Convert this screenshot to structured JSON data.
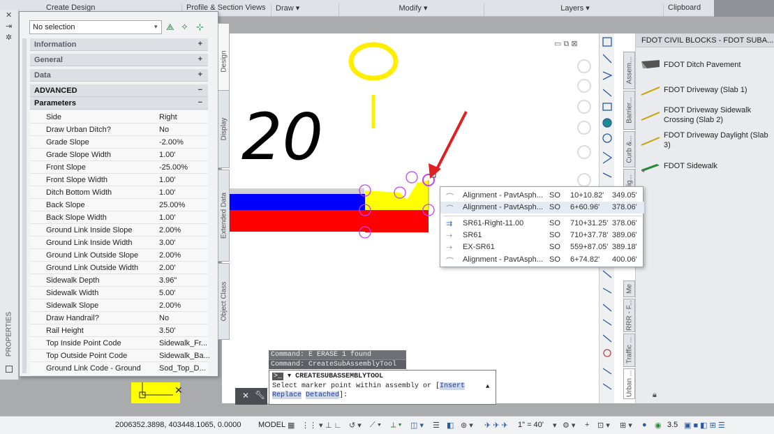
{
  "ribbon": {
    "panels": [
      "Create Design",
      "Profile & Section Views",
      "Draw ▾",
      "Modify ▾",
      "Layers ▾",
      "Clipboard"
    ]
  },
  "properties": {
    "selection": "No selection",
    "sidebar_label": "PROPERTIES",
    "sections": [
      {
        "label": "Information",
        "toggle": "+"
      },
      {
        "label": "General",
        "toggle": "+"
      },
      {
        "label": "Data",
        "toggle": "+"
      },
      {
        "label": "ADVANCED",
        "toggle": "−"
      },
      {
        "label": "Parameters",
        "toggle": "−"
      }
    ],
    "parameters": [
      {
        "label": "Side",
        "value": "Right"
      },
      {
        "label": "Draw Urban Ditch?",
        "value": "No"
      },
      {
        "label": "Grade Slope",
        "value": "-2.00%"
      },
      {
        "label": "Grade Slope Width",
        "value": "1.00'"
      },
      {
        "label": "Front Slope",
        "value": "-25.00%"
      },
      {
        "label": "Front Slope Width",
        "value": "1.00'"
      },
      {
        "label": "Ditch Bottom Width",
        "value": "1.00'"
      },
      {
        "label": "Back Slope",
        "value": "25.00%"
      },
      {
        "label": "Back Slope Width",
        "value": "1.00'"
      },
      {
        "label": "Ground Link Inside Slope",
        "value": "2.00%"
      },
      {
        "label": "Ground Link Inside Width",
        "value": "3.00'"
      },
      {
        "label": "Ground Link Outside Slope",
        "value": "2.00%"
      },
      {
        "label": "Ground Link Outside Width",
        "value": "2.00'"
      },
      {
        "label": "Sidewalk Depth",
        "value": "3.96\""
      },
      {
        "label": "Sidewalk Width",
        "value": "5.00'"
      },
      {
        "label": "Sidewalk Slope",
        "value": "2.00%"
      },
      {
        "label": "Draw Handrail?",
        "value": "No"
      },
      {
        "label": "Rail Height",
        "value": "3.50'"
      },
      {
        "label": "Top Inside Point Code",
        "value": "Sidewalk_Fr..."
      },
      {
        "label": "Top Outside Point Code",
        "value": "Sidewalk_Ba..."
      },
      {
        "label": "Ground Link Code - Ground",
        "value": "Sod_Top_D..."
      }
    ],
    "tabs": [
      "Design",
      "Display",
      "Extended Data",
      "Object Class"
    ]
  },
  "viewport": {
    "sketch_text": "20"
  },
  "popup": {
    "rows": [
      {
        "name": "Alignment - PavtAsph...",
        "type": "SO",
        "station": "10+10.82'",
        "offset": "349.05'"
      },
      {
        "name": "Alignment - PavtAsph...",
        "type": "SO",
        "station": "6+60.96'",
        "offset": "378.06'"
      },
      {
        "name": "SR61-Right-11.00",
        "type": "SO",
        "station": "710+31.25'",
        "offset": "378.06'"
      },
      {
        "name": "SR61",
        "type": "SO",
        "station": "710+37.78'",
        "offset": "389.06'"
      },
      {
        "name": "EX-SR61",
        "type": "SO",
        "station": "559+87.05'",
        "offset": "389.18'"
      },
      {
        "name": "Alignment - PavtAsph...",
        "type": "SO",
        "station": "6+74.82'",
        "offset": "400.06'"
      }
    ]
  },
  "palette": {
    "title": "FDOT CIVIL BLOCKS - FDOT SUBA...",
    "items": [
      "FDOT Ditch Pavement",
      "FDOT Driveway (Slab 1)",
      "FDOT Driveway Sidewalk Crossing (Slab 2)",
      "FDOT Driveway Daylight (Slab 3)",
      "FDOT Sidewalk"
    ],
    "tabs": [
      "Assem...",
      "Barrier...",
      "Curb &...",
      "Daylig...",
      "Me",
      "RRR - F...",
      "Traffic ...",
      "Urban ..."
    ]
  },
  "command": {
    "history": [
      "Command: E ERASE 1 found",
      "Command: CreateSubAssemblyTool"
    ],
    "current": "CREATESUBASSEMBLYTOOL",
    "prompt_text": "Select marker point within assembly or [",
    "option_insert": "Insert",
    "option_replace": "Replace",
    "option_detached": "Detached",
    "prompt_end": "]:"
  },
  "status": {
    "coords": "2006352.3898, 403448.1065, 0.0000",
    "model": "MODEL",
    "scale": "1\" = 40'",
    "number": "3.5"
  },
  "colors": {
    "red_layer": "#ff0000",
    "blue_layer": "#0000ff",
    "yellow_layer": "#ffff00",
    "marker": "#c040ff",
    "arrow": "#e02020"
  }
}
